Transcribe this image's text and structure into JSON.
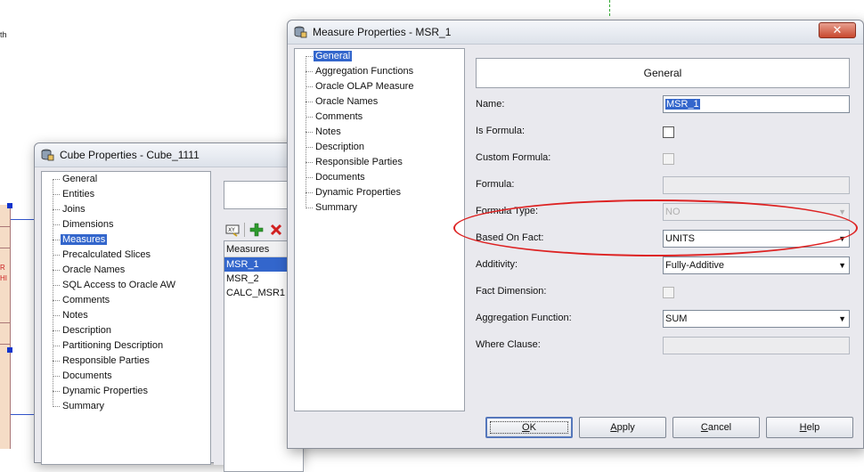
{
  "background": {
    "partial_label": "th",
    "diagram_fragments": [
      "R",
      "HI"
    ]
  },
  "cube_window": {
    "title": "Cube Properties - Cube_1111",
    "tree_items": [
      {
        "label": "General",
        "selected": false
      },
      {
        "label": "Entities",
        "selected": false
      },
      {
        "label": "Joins",
        "selected": false
      },
      {
        "label": "Dimensions",
        "selected": false
      },
      {
        "label": "Measures",
        "selected": true
      },
      {
        "label": "Precalculated Slices",
        "selected": false
      },
      {
        "label": "Oracle Names",
        "selected": false
      },
      {
        "label": "SQL Access to Oracle AW",
        "selected": false
      },
      {
        "label": "Comments",
        "selected": false
      },
      {
        "label": "Notes",
        "selected": false
      },
      {
        "label": "Description",
        "selected": false
      },
      {
        "label": "Partitioning Description",
        "selected": false
      },
      {
        "label": "Responsible Parties",
        "selected": false
      },
      {
        "label": "Documents",
        "selected": false
      },
      {
        "label": "Dynamic Properties",
        "selected": false
      },
      {
        "label": "Summary",
        "selected": false
      }
    ],
    "toolbar": {
      "icons": [
        "calculator-icon",
        "add-icon",
        "delete-icon"
      ],
      "colors": {
        "add": "#2e9a2e",
        "delete": "#d22020"
      }
    },
    "measures": {
      "header": "Measures",
      "rows": [
        {
          "label": "MSR_1",
          "selected": true
        },
        {
          "label": "MSR_2",
          "selected": false
        },
        {
          "label": "CALC_MSR1",
          "selected": false
        }
      ]
    }
  },
  "measure_window": {
    "title": "Measure Properties - MSR_1",
    "close_glyph": "✕",
    "tree_items": [
      {
        "label": "General",
        "selected": true
      },
      {
        "label": "Aggregation Functions",
        "selected": false
      },
      {
        "label": "Oracle OLAP Measure",
        "selected": false
      },
      {
        "label": "Oracle Names",
        "selected": false
      },
      {
        "label": "Comments",
        "selected": false
      },
      {
        "label": "Notes",
        "selected": false
      },
      {
        "label": "Description",
        "selected": false
      },
      {
        "label": "Responsible Parties",
        "selected": false
      },
      {
        "label": "Documents",
        "selected": false
      },
      {
        "label": "Dynamic Properties",
        "selected": false
      },
      {
        "label": "Summary",
        "selected": false
      }
    ],
    "panel": {
      "header": "General",
      "fields": {
        "name": {
          "label": "Name:",
          "value": "MSR_1"
        },
        "is_formula": {
          "label": "Is Formula:",
          "checked": false
        },
        "custom_formula": {
          "label": "Custom Formula:",
          "checked": false,
          "enabled": false
        },
        "formula": {
          "label": "Formula:",
          "value": "",
          "enabled": false
        },
        "formula_type": {
          "label": "Formula Type:",
          "value": "NO",
          "enabled": false
        },
        "based_on_fact": {
          "label": "Based On Fact:",
          "value": "UNITS"
        },
        "additivity": {
          "label": "Additivity:",
          "value": "Fully-Additive"
        },
        "fact_dimension": {
          "label": "Fact Dimension:",
          "checked": false,
          "enabled": false
        },
        "aggregation_function": {
          "label": "Aggregation Function:",
          "value": "SUM"
        },
        "where_clause": {
          "label": "Where Clause:",
          "value": "",
          "enabled": false
        }
      },
      "highlight_color": "#dd2222"
    },
    "buttons": {
      "ok": {
        "label": "OK",
        "mnemonic": "O",
        "rest": "K"
      },
      "apply": {
        "label": "Apply",
        "mnemonic": "A",
        "rest": "pply"
      },
      "cancel": {
        "label": "Cancel",
        "mnemonic": "C",
        "rest": "ancel"
      },
      "help": {
        "label": "Help",
        "mnemonic": "H",
        "rest": "elp"
      }
    }
  }
}
